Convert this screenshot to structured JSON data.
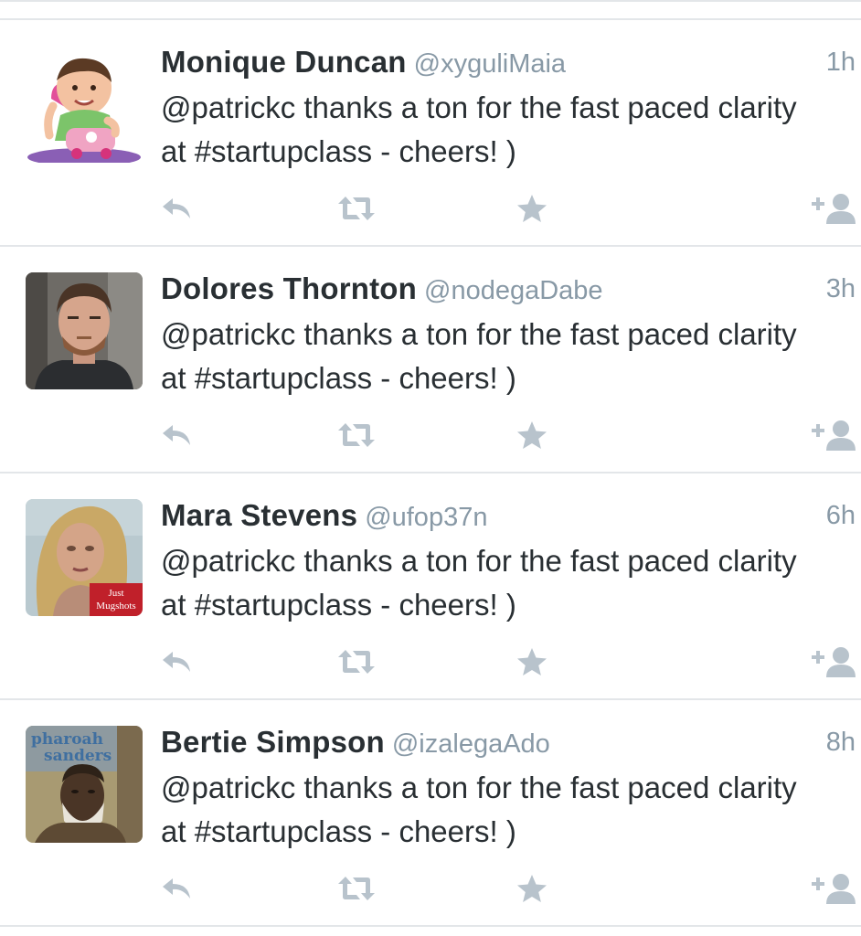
{
  "colors": {
    "name": "#292f33",
    "meta": "#8899a6",
    "icon": "#b8c3cc",
    "divider": "#e3e6e9"
  },
  "tweets": [
    {
      "name": "Monique Duncan",
      "handle": "@xyguliMaia",
      "time": "1h",
      "text": "@patrickc thanks a ton for the fast paced clarity at #startupclass - cheers! )",
      "avatar": "baby-with-toy-phone-photo"
    },
    {
      "name": "Dolores Thornton",
      "handle": "@nodegaDabe",
      "time": "3h",
      "text": "@patrickc thanks a ton for the fast paced clarity at #startupclass - cheers! )",
      "avatar": "bearded-man-photo"
    },
    {
      "name": "Mara Stevens",
      "handle": "@ufop37n",
      "time": "6h",
      "text": "@patrickc thanks a ton for the fast paced clarity at #startupclass - cheers! )",
      "avatar": "mugshot-photo",
      "avatar_badge": [
        "Just",
        "Mugshots"
      ]
    },
    {
      "name": "Bertie Simpson",
      "handle": "@izalegaAdo",
      "time": "8h",
      "text": "@patrickc thanks a ton for the fast paced clarity at #startupclass - cheers! )",
      "avatar": "pharoah-sanders-album-cover",
      "avatar_cover_text": [
        "pharoah",
        "sanders"
      ]
    }
  ],
  "actions": {
    "reply_icon": "reply-icon",
    "retweet_icon": "retweet-icon",
    "favorite_icon": "star-icon",
    "follow_icon": "follow-user-icon"
  }
}
